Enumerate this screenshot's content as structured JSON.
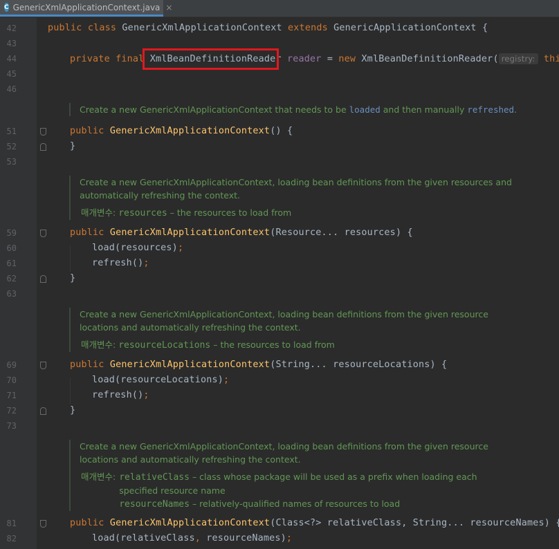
{
  "tab": {
    "icon": "C",
    "label": "GenericXmlApplicationContext.java",
    "close": "×"
  },
  "lines": [
    {
      "n": "42"
    },
    {
      "n": "43"
    },
    {
      "n": "44"
    },
    {
      "n": "45"
    },
    {
      "n": "46"
    },
    {
      "n": "51"
    },
    {
      "n": "52"
    },
    {
      "n": "53"
    },
    {
      "n": "59"
    },
    {
      "n": "60"
    },
    {
      "n": "61"
    },
    {
      "n": "62"
    },
    {
      "n": "63"
    },
    {
      "n": "69"
    },
    {
      "n": "70"
    },
    {
      "n": "71"
    },
    {
      "n": "72"
    },
    {
      "n": "73"
    },
    {
      "n": "81"
    },
    {
      "n": "82"
    }
  ],
  "code": {
    "l42": {
      "kw1": "public",
      "kw2": "class",
      "name": "GenericXmlApplicationContext",
      "kw3": "extends",
      "parent": "GenericApplicationContext {"
    },
    "l44": {
      "kw1": "private",
      "kw2": "final",
      "type": "XmlBeanDefinitionReader",
      "field": "reader",
      "eq": " = ",
      "kw3": "new",
      "ctor": "XmlBeanDefinitionReader(",
      "hint": "registry:",
      "kw4": "this",
      "end": ");"
    },
    "l51": {
      "kw": "public",
      "m": "GenericXmlApplicationContext",
      "rest": "() {"
    },
    "l52": "}",
    "l59": {
      "kw": "public",
      "m": "GenericXmlApplicationContext",
      "rest": "(Resource... resources) {"
    },
    "l60": {
      "call": "load(resources)",
      "semi": ";"
    },
    "l61": {
      "call": "refresh()",
      "semi": ";"
    },
    "l62": "}",
    "l69": {
      "kw": "public",
      "m": "GenericXmlApplicationContext",
      "rest": "(String... resourceLocations) {"
    },
    "l70": {
      "call": "load(resourceLocations)",
      "semi": ";"
    },
    "l71": {
      "call": "refresh()",
      "semi": ";"
    },
    "l72": "}",
    "l81": {
      "kw": "public",
      "m": "GenericXmlApplicationContext",
      "rest": "(Class<?> relativeClass, String... resourceNames) {"
    },
    "l82": {
      "call": "load(relativeClass",
      "comma": ",",
      "call2": " resourceNames)",
      "semi": ";"
    }
  },
  "docs": {
    "d1": {
      "a": "Create a new GenericXmlApplicationContext that needs to be ",
      "k1": "loaded",
      "b": " and then manually ",
      "k2": "refreshed",
      "c": "."
    },
    "d2": {
      "l1": "Create a new GenericXmlApplicationContext, loading bean definitions from the given resources and",
      "l2": "automatically refreshing the context.",
      "label": "매개변수:",
      "p1": "resources",
      "p1d": " – the resources to load from"
    },
    "d3": {
      "l1": "Create a new GenericXmlApplicationContext, loading bean definitions from the given resource",
      "l2": "locations and automatically refreshing the context.",
      "label": "매개변수:",
      "p1": "resourceLocations",
      "p1d": " – the resources to load from"
    },
    "d4": {
      "l1": "Create a new GenericXmlApplicationContext, loading bean definitions from the given resource",
      "l2": "locations and automatically refreshing the context.",
      "label": "매개변수:",
      "p1": "relativeClass",
      "p1d": " – class whose package will be used as a prefix when loading each",
      "p1d2": "specified resource name",
      "p2": "resourceNames",
      "p2d": " – relatively-qualified names of resources to load"
    }
  }
}
